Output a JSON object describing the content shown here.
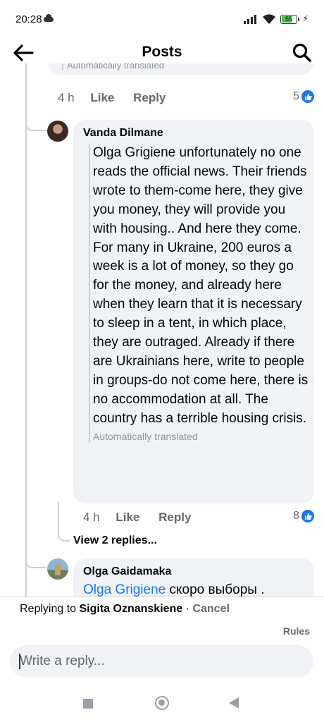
{
  "status_bar": {
    "time": "20:28",
    "battery": "55"
  },
  "header": {
    "title": "Posts"
  },
  "previous_comment": {
    "translation_label": "Automatically translated",
    "time": "4 h",
    "like_label": "Like",
    "reply_label": "Reply",
    "reaction_count": "5"
  },
  "comments": [
    {
      "author": "Vanda Dilmane",
      "text": "Olga Grigiene unfortunately no one reads the official news. Their friends wrote to them-come here, they give you money, they will provide you with housing.. And here they come. For many in Ukraine, 200 euros a week is a lot of money, so they go for the money, and already here when they learn that it is necessary to sleep in a tent, in which place, they are outraged. Already if there are Ukrainians here, write to people in groups-do not come here, there is no accommodation at all. The country has a terrible housing crisis.",
      "translation_label": "Automatically translated",
      "time": "4 h",
      "like_label": "Like",
      "reply_label": "Reply",
      "reaction_count": "8",
      "view_replies": "View 2 replies..."
    },
    {
      "author": "Olga Gaidamaka",
      "mention": "Olga Grigiene",
      "text": " скоро выборы ."
    }
  ],
  "composer": {
    "replying_prefix": "Replying to ",
    "replying_name": "Sigita Oznanskiene",
    "separator": " · ",
    "cancel_label": "Cancel",
    "rules_label": "Rules",
    "placeholder": "Write a reply..."
  },
  "colors": {
    "accent": "#1877f2",
    "bubble": "#f0f2f5",
    "secondary_text": "#65676b"
  },
  "icons": [
    "arrow-left-icon",
    "search-icon",
    "like-icon",
    "recents-icon",
    "home-icon",
    "back-triangle-icon"
  ]
}
